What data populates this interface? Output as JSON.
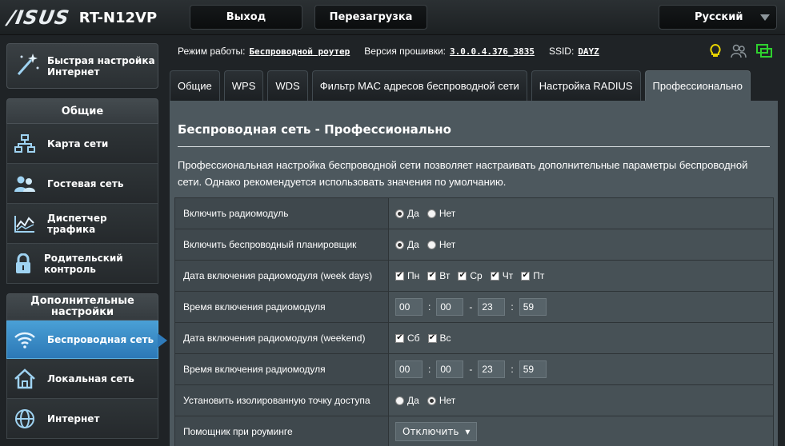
{
  "header": {
    "brand": "/ISUS",
    "model": "RT-N12VP",
    "logout": "Выход",
    "reboot": "Перезагрузка",
    "language": "Русский"
  },
  "sidebar": {
    "quick_setup": "Быстрая настройка Интернет",
    "general_title": "Общие",
    "general_items": [
      {
        "label": "Карта сети",
        "icon": "network-map-icon"
      },
      {
        "label": "Гостевая сеть",
        "icon": "guest-network-icon"
      },
      {
        "label": "Диспетчер трафика",
        "icon": "traffic-manager-icon"
      },
      {
        "label": "Родительский контроль",
        "icon": "lock-icon"
      }
    ],
    "advanced_title": "Дополнительные настройки",
    "advanced_items": [
      {
        "label": "Беспроводная сеть",
        "icon": "wifi-icon",
        "active": true
      },
      {
        "label": "Локальная сеть",
        "icon": "home-icon"
      },
      {
        "label": "Интернет",
        "icon": "globe-icon"
      }
    ]
  },
  "infobar": {
    "mode_label": "Режим работы:",
    "mode_value": "Беспроводной роутер",
    "fw_label": "Версия прошивки:",
    "fw_value": "3.0.0.4.376_3835",
    "ssid_label": "SSID:",
    "ssid_value": "DAYZ"
  },
  "tabs": [
    {
      "label": "Общие"
    },
    {
      "label": "WPS"
    },
    {
      "label": "WDS"
    },
    {
      "label": "Фильтр MAC адресов беспроводной сети"
    },
    {
      "label": "Настройка RADIUS"
    },
    {
      "label": "Профессионально",
      "active": true
    }
  ],
  "panel": {
    "title": "Беспроводная сеть - Профессионально",
    "description": "Профессиональная настройка беспроводной сети позволяет настраивать дополнительные параметры беспроводной сети. Однако рекомендуется использовать значения по умолчанию."
  },
  "settings": {
    "radio_enable": {
      "label": "Включить радиомодуль",
      "yes": "Да",
      "no": "Нет",
      "selected": "yes"
    },
    "scheduler": {
      "label": "Включить беспроводный планировщик",
      "yes": "Да",
      "no": "Нет",
      "selected": "yes"
    },
    "weekdays": {
      "label": "Дата включения радиомодуля (week days)",
      "days": [
        "Пн",
        "Вт",
        "Ср",
        "Чт",
        "Пт"
      ]
    },
    "weekday_time": {
      "label": "Время включения радиомодуля",
      "start_h": "00",
      "start_m": "00",
      "end_h": "23",
      "end_m": "59",
      "dash": "-",
      "colon": ":"
    },
    "weekend": {
      "label": "Дата включения радиомодуля (weekend)",
      "days": [
        "Сб",
        "Вс"
      ]
    },
    "weekend_time": {
      "label": "Время включения радиомодуля",
      "start_h": "00",
      "start_m": "00",
      "end_h": "23",
      "end_m": "59",
      "dash": "-",
      "colon": ":"
    },
    "isolation": {
      "label": "Установить изолированную точку доступа",
      "yes": "Да",
      "no": "Нет",
      "selected": "no"
    },
    "roaming": {
      "label": "Помощник при роуминге",
      "value": "Отключить"
    }
  },
  "colors": {
    "accent": "#2c78b6",
    "panel_bg": "#4d585e",
    "bulb": "#e8d400",
    "usb": "#2fd12f"
  }
}
